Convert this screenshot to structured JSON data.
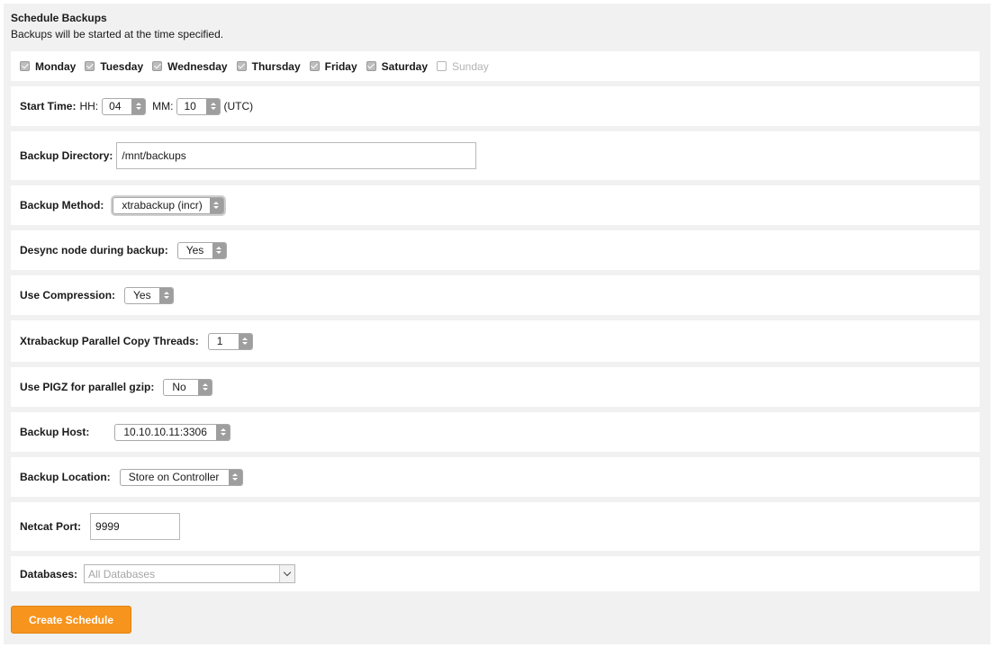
{
  "header": {
    "title": "Schedule Backups",
    "subtitle": "Backups will be started at the time specified."
  },
  "days": [
    {
      "label": "Monday",
      "checked": true
    },
    {
      "label": "Tuesday",
      "checked": true
    },
    {
      "label": "Wednesday",
      "checked": true
    },
    {
      "label": "Thursday",
      "checked": true
    },
    {
      "label": "Friday",
      "checked": true
    },
    {
      "label": "Saturday",
      "checked": true
    },
    {
      "label": "Sunday",
      "checked": false
    }
  ],
  "start_time": {
    "label": "Start Time:",
    "hh_label": "HH:",
    "hh_value": "04",
    "mm_label": "MM:",
    "mm_value": "10",
    "tz": "(UTC)"
  },
  "backup_directory": {
    "label": "Backup Directory:",
    "value": "/mnt/backups"
  },
  "backup_method": {
    "label": "Backup Method:",
    "value": "xtrabackup (incr)"
  },
  "desync": {
    "label": "Desync node during backup:",
    "value": "Yes"
  },
  "compression": {
    "label": "Use Compression:",
    "value": "Yes"
  },
  "parallel_threads": {
    "label": "Xtrabackup Parallel Copy Threads:",
    "value": "1"
  },
  "pigz": {
    "label": "Use PIGZ for parallel gzip:",
    "value": "No"
  },
  "backup_host": {
    "label": "Backup Host:",
    "value": "10.10.10.11:3306"
  },
  "backup_location": {
    "label": "Backup Location:",
    "value": "Store on Controller"
  },
  "netcat_port": {
    "label": "Netcat Port:",
    "value": "9999"
  },
  "databases": {
    "label": "Databases:",
    "placeholder": "All Databases"
  },
  "actions": {
    "create_label": "Create Schedule"
  },
  "colors": {
    "accent": "#f7941e",
    "panel": "#f1f1f1"
  }
}
